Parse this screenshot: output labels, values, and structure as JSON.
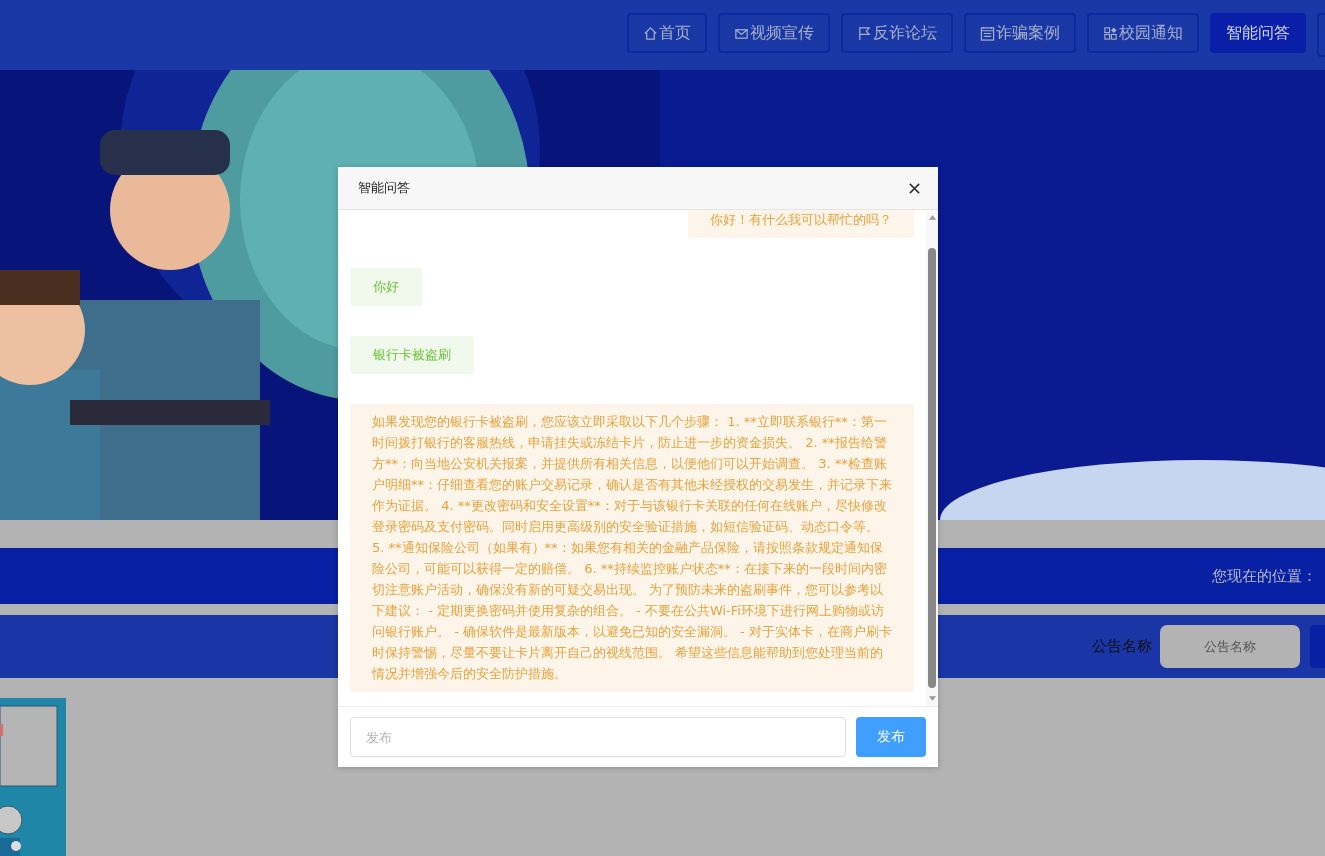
{
  "nav": [
    {
      "label": "首页",
      "kind": "home",
      "selected": false
    },
    {
      "label": "视频宣传",
      "kind": "mail",
      "selected": false
    },
    {
      "label": "反诈论坛",
      "kind": "flag",
      "selected": false
    },
    {
      "label": "诈骗案例",
      "kind": "doc",
      "selected": false
    },
    {
      "label": "校园通知",
      "kind": "grid",
      "selected": false
    },
    {
      "label": "智能问答",
      "kind": "plain",
      "selected": true
    }
  ],
  "breadcrumb": {
    "label": "您现在的位置："
  },
  "filter": {
    "label": "公告名称",
    "placeholder": "公告名称"
  },
  "dialog": {
    "title": "智能问答",
    "messages": [
      {
        "kind": "bot",
        "text": "你好！有什么我可以帮忙的吗？"
      },
      {
        "kind": "user",
        "text": "你好"
      },
      {
        "kind": "user",
        "text": "银行卡被盗刷"
      },
      {
        "kind": "bot",
        "text": "如果发现您的银行卡被盗刷，您应该立即采取以下几个步骤： 1. **立即联系银行**：第一时间拨打银行的客服热线，申请挂失或冻结卡片，防止进一步的资金损失。 2. **报告给警方**：向当地公安机关报案，并提供所有相关信息，以便他们可以开始调查。 3. **检查账户明细**：仔细查看您的账户交易记录，确认是否有其他未经授权的交易发生，并记录下来作为证据。 4. **更改密码和安全设置**：对于与该银行卡关联的任何在线账户，尽快修改登录密码及支付密码。同时启用更高级别的安全验证措施，如短信验证码、动态口令等。 5. **通知保险公司（如果有）**：如果您有相关的金融产品保险，请按照条款规定通知保险公司，可能可以获得一定的赔偿。 6. **持续监控账户状态**：在接下来的一段时间内密切注意账户活动，确保没有新的可疑交易出现。 为了预防未来的盗刷事件，您可以参考以下建议： - 定期更换密码并使用复杂的组合。 - 不要在公共Wi-Fi环境下进行网上购物或访问银行账户。 - 确保软件是最新版本，以避免已知的安全漏洞。 - 对于实体卡，在商户刷卡时保持警惕，尽量不要让卡片离开自己的视线范围。 希望这些信息能帮助到您处理当前的情况并增强今后的安全防护措施。"
      }
    ],
    "input": {
      "placeholder": "发布"
    },
    "send": "发布"
  }
}
